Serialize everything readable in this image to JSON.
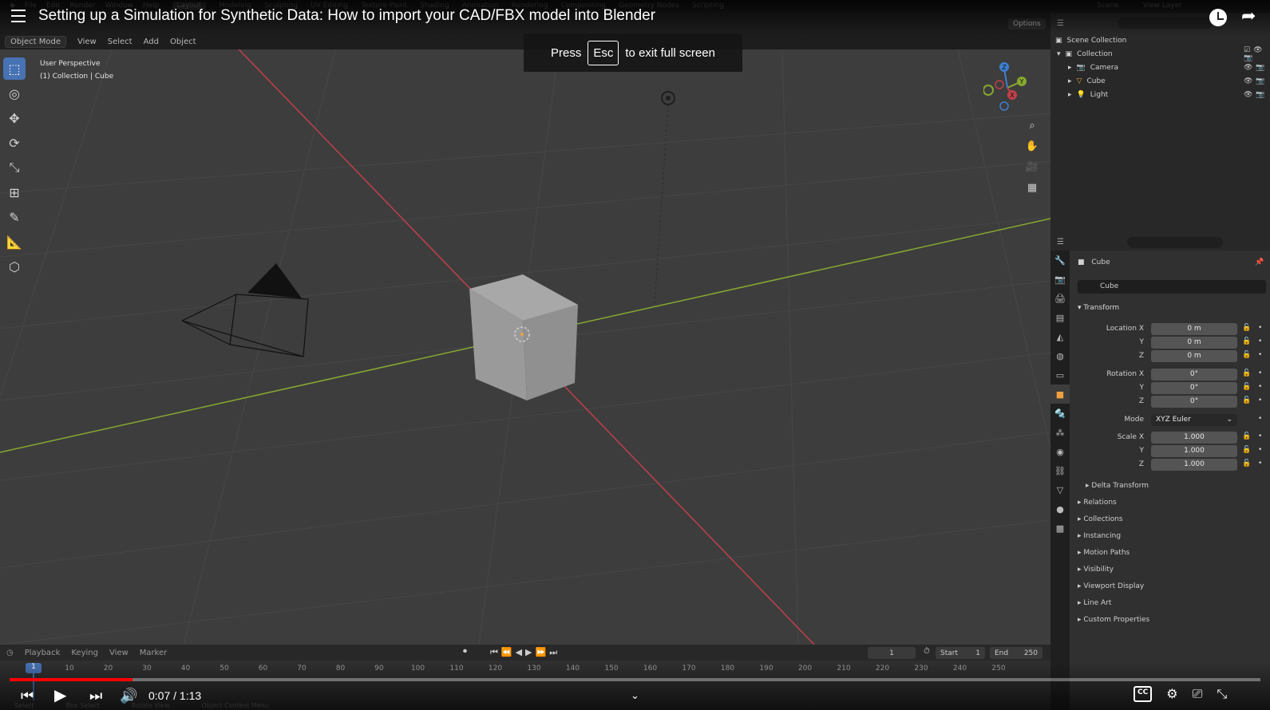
{
  "video": {
    "title": "Setting up a Simulation for Synthetic Data: How to import your CAD/FBX model into Blender",
    "time_display": "0:07 / 1:13",
    "progress_fraction": 0.098
  },
  "toast": {
    "press": "Press",
    "key": "Esc",
    "rest": "to exit full screen"
  },
  "menus": {
    "top": [
      "File",
      "Edit",
      "Render",
      "Window",
      "Help"
    ],
    "workspaces": [
      "Layout",
      "Modeling",
      "Sculpting",
      "UV Editing",
      "Texture Paint",
      "Shading",
      "Animation",
      "Rendering",
      "Compositing",
      "Geometry Nodes",
      "Scripting"
    ],
    "scene": "Scene",
    "view_layer": "View Layer"
  },
  "viewport": {
    "mode": "Object Mode",
    "menu": [
      "View",
      "Select",
      "Add",
      "Object"
    ],
    "options": "Options",
    "info_line1": "User Perspective",
    "info_line2": "(1) Collection | Cube",
    "colors": {
      "background": "#3d3d3d",
      "x_axis": "#c0404a",
      "y_axis": "#88a830",
      "selection": "#4772b3"
    }
  },
  "outliner": {
    "root": "Scene Collection",
    "collection": "Collection",
    "items": [
      "Camera",
      "Cube",
      "Light"
    ]
  },
  "properties": {
    "crumb": "Cube",
    "object_name": "Cube",
    "transform_title": "Transform",
    "location_label": "Location X",
    "rotation_label": "Rotation X",
    "scale_label": "Scale X",
    "axis_y": "Y",
    "axis_z": "Z",
    "loc": [
      "0 m",
      "0 m",
      "0 m"
    ],
    "rot": [
      "0°",
      "0°",
      "0°"
    ],
    "mode_label": "Mode",
    "mode_value": "XYZ Euler",
    "scale": [
      "1.000",
      "1.000",
      "1.000"
    ],
    "delta": "Delta Transform",
    "panels": [
      "Relations",
      "Collections",
      "Instancing",
      "Motion Paths",
      "Visibility",
      "Viewport Display",
      "Line Art",
      "Custom Properties"
    ]
  },
  "timeline": {
    "menu": [
      "Playback",
      "Keying",
      "View",
      "Marker"
    ],
    "current_frame": "1",
    "start_label": "Start",
    "start": "1",
    "end_label": "End",
    "end": "250",
    "ticks": [
      "10",
      "20",
      "30",
      "40",
      "50",
      "60",
      "70",
      "80",
      "90",
      "100",
      "110",
      "120",
      "130",
      "140",
      "150",
      "160",
      "170",
      "180",
      "190",
      "200",
      "210",
      "220",
      "230",
      "240",
      "250"
    ],
    "ruler_frame": "1"
  },
  "statusbar": [
    "Select",
    "Box Select",
    "Rotate View",
    "Object Context Menu"
  ],
  "gizmo": {
    "x": "X",
    "y": "Y",
    "z": "Z"
  }
}
